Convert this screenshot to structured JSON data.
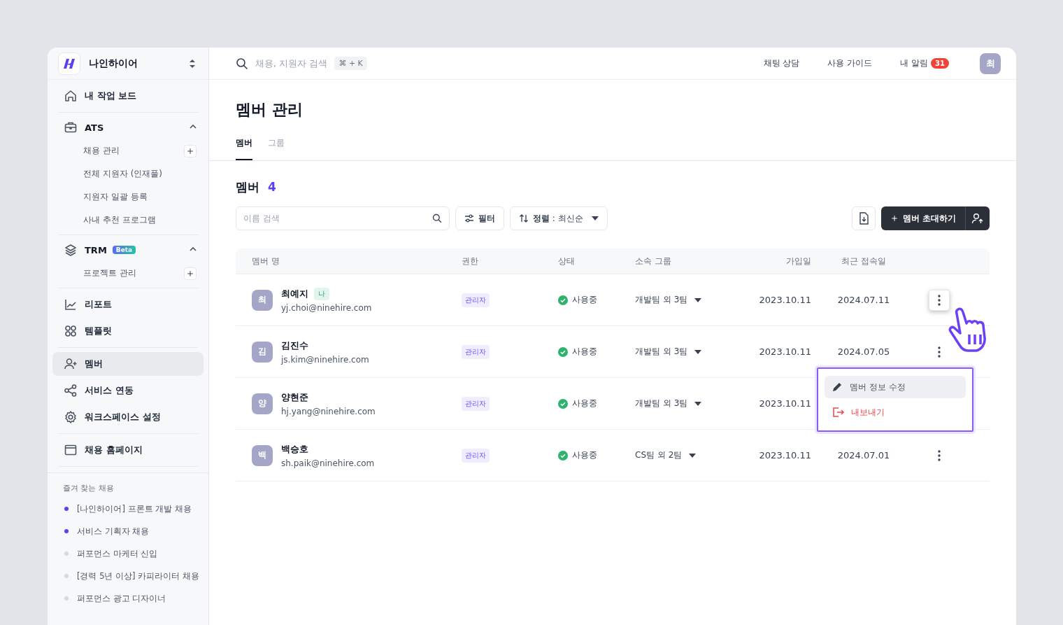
{
  "workspace": {
    "name": "나인하이어"
  },
  "nav_groups": [
    {
      "items": [
        {
          "kind": "link",
          "label": "내 작업 보드",
          "selected": false
        }
      ]
    },
    {
      "items": [
        {
          "kind": "section",
          "label": "ATS",
          "expanded": true,
          "children": [
            {
              "label": "채용 관리",
              "has_add": true
            },
            {
              "label": "전체 지원자 (인재풀)",
              "has_add": false
            },
            {
              "label": "지원자 일괄 등록",
              "has_add": false
            },
            {
              "label": "사내 추천 프로그램",
              "has_add": false
            }
          ]
        }
      ]
    },
    {
      "items": [
        {
          "kind": "section",
          "label": "TRM",
          "badge": "Beta",
          "expanded": true,
          "children": [
            {
              "label": "프로젝트 관리",
              "has_add": true
            }
          ]
        }
      ]
    },
    {
      "items": [
        {
          "kind": "link",
          "label": "리포트",
          "selected": false
        },
        {
          "kind": "link",
          "label": "템플릿",
          "selected": false
        }
      ]
    },
    {
      "items": [
        {
          "kind": "link",
          "label": "멤버",
          "selected": true
        },
        {
          "kind": "link",
          "label": "서비스 연동",
          "selected": false
        },
        {
          "kind": "link",
          "label": "워크스페이스 설정",
          "selected": false
        }
      ]
    },
    {
      "items": [
        {
          "kind": "link",
          "label": "채용 홈페이지",
          "selected": false
        }
      ]
    }
  ],
  "favorites": {
    "title": "즐겨 찾는 채용",
    "items": [
      {
        "label": "[나인하이어] 프론트 개발 채용",
        "color": "#5b3ff0"
      },
      {
        "label": "서비스 기획자 채용",
        "color": "#5b3ff0"
      },
      {
        "label": "퍼포먼스 마케터 신입",
        "color": "#d5d8de"
      },
      {
        "label": "[경력 5년 이상] 카피라이터 채용",
        "color": "#d5d8de"
      },
      {
        "label": "퍼포먼스 광고 디자이너",
        "color": "#d5d8de"
      }
    ]
  },
  "topbar": {
    "search_placeholder": "채용, 지원자 검색",
    "shortcut": "⌘ + K",
    "links": [
      "채팅 상담",
      "사용 가이드"
    ],
    "notifications": {
      "label": "내 알림",
      "count": "31"
    },
    "avatar": "최"
  },
  "page": {
    "title": "멤버 관리",
    "tabs": [
      {
        "label": "멤버",
        "selected": true
      },
      {
        "label": "그룹",
        "selected": false
      }
    ],
    "heading": "멤버",
    "count": "4",
    "search_placeholder": "이름 검색",
    "filter": "필터",
    "sort": "**정렬** : 최신순",
    "invite": "멤버 초대하기"
  },
  "table": {
    "columns": [
      "멤버 명",
      "권한",
      "상태",
      "소속 그룹",
      "가입일",
      "최근 접속일"
    ],
    "rows": [
      {
        "avatar": "최",
        "name": "최예지",
        "me_badge": "나",
        "email": "yj.choi@ninehire.com",
        "role": "관리자",
        "status": "사용중",
        "group": "개발팀 외 3팀",
        "joined": "2023.10.11",
        "last_access": "2024.07.11",
        "hovered": true
      },
      {
        "avatar": "김",
        "name": "김진수",
        "email": "js.kim@ninehire.com",
        "role": "관리자",
        "status": "사용중",
        "group": "개발팀 외 3팀",
        "joined": "2023.10.11",
        "last_access": "2024.07.05",
        "hovered": false
      },
      {
        "avatar": "양",
        "name": "양현준",
        "email": "hj.yang@ninehire.com",
        "role": "관리자",
        "status": "사용중",
        "group": "개발팀 외 3팀",
        "joined": "2023.10.11"
      },
      {
        "avatar": "백",
        "name": "백승호",
        "email": "sh.paik@ninehire.com",
        "role": "관리자",
        "status": "사용중",
        "group": "CS팀 외 2팀",
        "joined": "2023.10.11",
        "last_access": "2024.07.01",
        "hovered": false
      }
    ]
  },
  "context_menu": {
    "items": [
      {
        "kind": "edit",
        "label": "멤버 정보 수정",
        "selected": true
      },
      {
        "kind": "danger",
        "label": "내보내기",
        "selected": false
      }
    ]
  }
}
